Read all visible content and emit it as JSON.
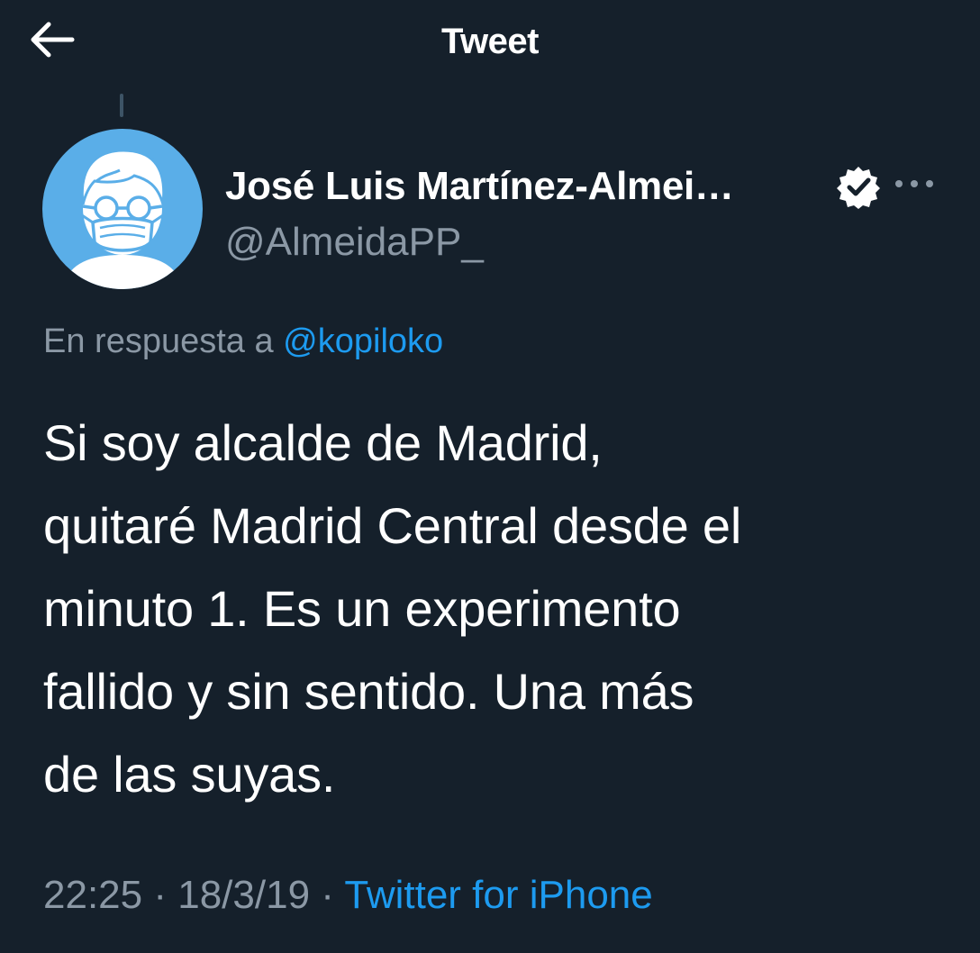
{
  "header": {
    "title": "Tweet",
    "back_icon": "arrow-left-icon"
  },
  "tweet": {
    "author": {
      "name": "José Luis Martínez-Almei…",
      "handle": "@AlmeidaPP_",
      "avatar_color": "#5aaee8",
      "verified_icon": "verified-badge-icon"
    },
    "more_icon": "more-horizontal-icon",
    "reply": {
      "prefix": "En respuesta a",
      "mention": "@kopiloko"
    },
    "text_lines": [
      "Si soy alcalde de Madrid,",
      "quitaré Madrid Central desde el",
      "minuto 1. Es un experimento",
      "fallido y sin sentido. Una más",
      "de las suyas."
    ],
    "time": "22:25",
    "separator": "·",
    "date": "18/3/19",
    "source": "Twitter for iPhone"
  },
  "colors": {
    "background": "#15202b",
    "text": "#ffffff",
    "secondary_text": "#8b98a5",
    "link": "#1d9bf0"
  }
}
